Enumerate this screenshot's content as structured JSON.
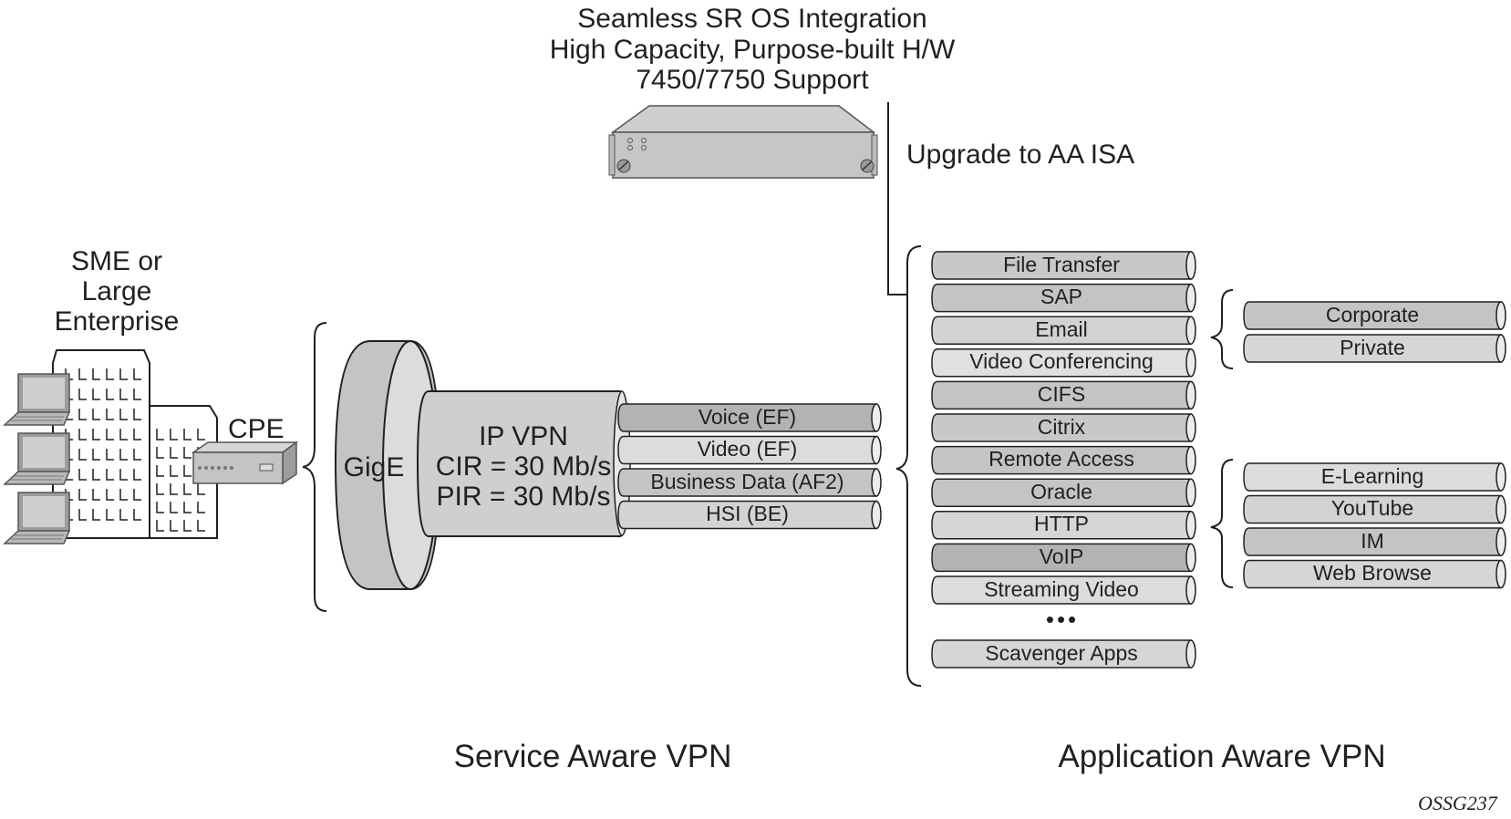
{
  "header": {
    "lines": [
      "Seamless SR OS Integration",
      "High Capacity, Purpose-built H/W",
      "7450/7750 Support"
    ],
    "upgrade_label": "Upgrade to AA ISA"
  },
  "enterprise": {
    "lines": [
      "SME or",
      "Large",
      "Enterprise"
    ],
    "cpe_label": "CPE"
  },
  "service_vpn": {
    "gige_label": "GigE",
    "vpn_lines": [
      "IP VPN",
      "CIR = 30 Mb/s",
      "PIR = 30 Mb/s"
    ],
    "classes": [
      {
        "label": "Voice (EF)",
        "shade": "#b3b3b5"
      },
      {
        "label": "Video (EF)",
        "shade": "#dcdcdd"
      },
      {
        "label": "Business Data (AF2)",
        "shade": "#c4c4c6"
      },
      {
        "label": "HSI (BE)",
        "shade": "#d3d3d4"
      }
    ],
    "caption": "Service Aware VPN"
  },
  "app_vpn": {
    "apps": [
      {
        "label": "File Transfer",
        "shade": "#c8c8ca"
      },
      {
        "label": "SAP",
        "shade": "#c4c4c6"
      },
      {
        "label": "Email",
        "shade": "#d3d3d4"
      },
      {
        "label": "Video Conferencing",
        "shade": "#e0e0e1"
      },
      {
        "label": "CIFS",
        "shade": "#c4c4c6"
      },
      {
        "label": "Citrix",
        "shade": "#c8c8ca"
      },
      {
        "label": "Remote Access",
        "shade": "#c4c4c6"
      },
      {
        "label": "Oracle",
        "shade": "#c4c4c6"
      },
      {
        "label": "HTTP",
        "shade": "#d6d6d7"
      },
      {
        "label": "VoIP",
        "shade": "#b3b3b5"
      },
      {
        "label": "Streaming Video",
        "shade": "#dcdcdd"
      }
    ],
    "ellipsis": "•••",
    "last_app": {
      "label": "Scavenger Apps",
      "shade": "#d6d6d7"
    },
    "email_sub": [
      {
        "label": "Corporate",
        "shade": "#c4c4c6"
      },
      {
        "label": "Private",
        "shade": "#d6d6d7"
      }
    ],
    "http_sub": [
      {
        "label": "E-Learning",
        "shade": "#dcdcdd"
      },
      {
        "label": "YouTube",
        "shade": "#d3d3d4"
      },
      {
        "label": "IM",
        "shade": "#c4c4c6"
      },
      {
        "label": "Web Browse",
        "shade": "#d6d6d7"
      }
    ],
    "caption": "Application Aware VPN"
  },
  "figure_id": "OSSG237"
}
